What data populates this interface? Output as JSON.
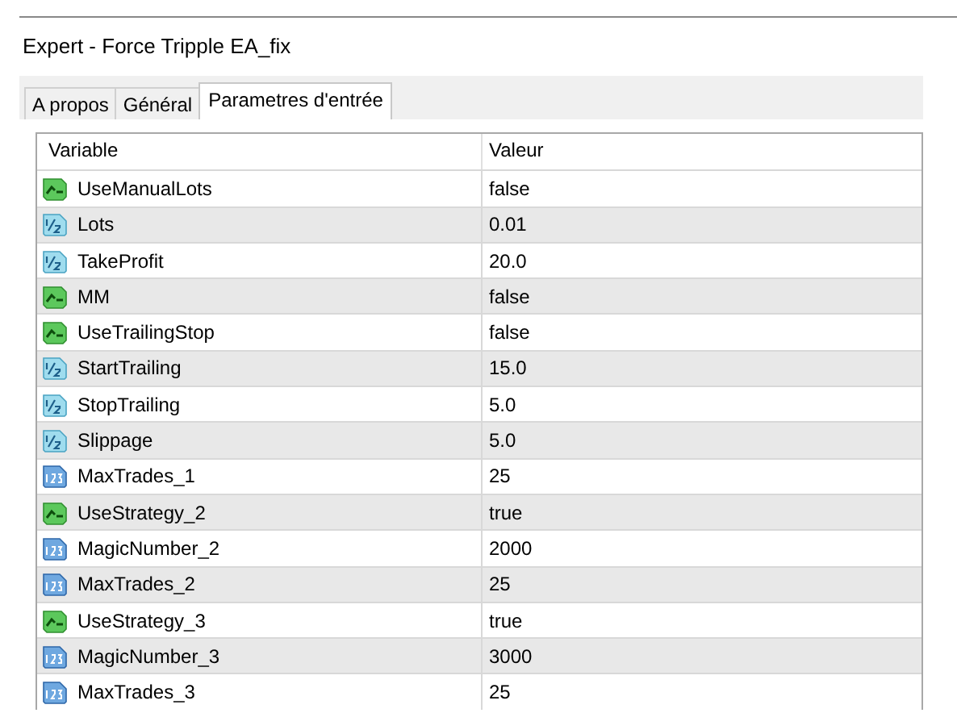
{
  "window": {
    "title": "Expert - Force Tripple EA_fix"
  },
  "tabs": [
    {
      "label": "A propos",
      "selected": false
    },
    {
      "label": "Général",
      "selected": false
    },
    {
      "label": "Parametres d'entrée",
      "selected": true
    }
  ],
  "table": {
    "columns": [
      "Variable",
      "Valeur"
    ],
    "rows": [
      {
        "kind": "bool",
        "name": "UseManualLots",
        "value": "false"
      },
      {
        "kind": "double",
        "name": "Lots",
        "value": "0.01"
      },
      {
        "kind": "double",
        "name": "TakeProfit",
        "value": "20.0"
      },
      {
        "kind": "bool",
        "name": "MM",
        "value": "false"
      },
      {
        "kind": "bool",
        "name": "UseTrailingStop",
        "value": "false"
      },
      {
        "kind": "double",
        "name": "StartTrailing",
        "value": "15.0"
      },
      {
        "kind": "double",
        "name": "StopTrailing",
        "value": "5.0"
      },
      {
        "kind": "double",
        "name": "Slippage",
        "value": "5.0"
      },
      {
        "kind": "int",
        "name": "MaxTrades_1",
        "value": "25"
      },
      {
        "kind": "bool",
        "name": "UseStrategy_2",
        "value": "true"
      },
      {
        "kind": "int",
        "name": "MagicNumber_2",
        "value": "2000"
      },
      {
        "kind": "int",
        "name": "MaxTrades_2",
        "value": "25"
      },
      {
        "kind": "bool",
        "name": "UseStrategy_3",
        "value": "true"
      },
      {
        "kind": "int",
        "name": "MagicNumber_3",
        "value": "3000"
      },
      {
        "kind": "int",
        "name": "MaxTrades_3",
        "value": "25"
      }
    ]
  }
}
